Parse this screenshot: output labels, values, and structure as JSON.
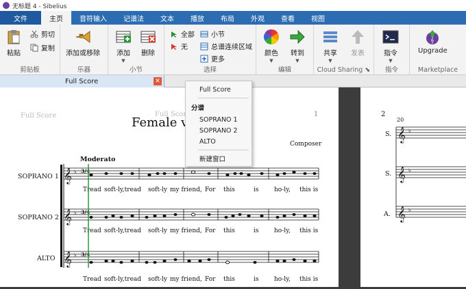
{
  "window": {
    "title": "无标题 4 - Sibelius"
  },
  "tabs": [
    {
      "label": "文件"
    },
    {
      "label": "主页"
    },
    {
      "label": "音符输入"
    },
    {
      "label": "记谱法"
    },
    {
      "label": "文本"
    },
    {
      "label": "播放"
    },
    {
      "label": "布局"
    },
    {
      "label": "外观"
    },
    {
      "label": "查看"
    },
    {
      "label": "视图"
    }
  ],
  "ribbon": {
    "clipboard": {
      "label": "剪贴板",
      "paste": "粘贴",
      "cut": "剪切",
      "copy": "复制"
    },
    "instruments": {
      "label": "乐器",
      "add_remove": "添加或移除"
    },
    "bars": {
      "label": "小节",
      "add": "添加",
      "delete": "删除"
    },
    "select": {
      "label": "选择",
      "all": "全部",
      "none": "无",
      "more": "更多",
      "bar": "小节",
      "system_passage": "总谱连续区域"
    },
    "edit": {
      "label": "编辑",
      "color": "颜色",
      "goto": "转到"
    },
    "cloud": {
      "label": "Cloud Sharing",
      "share": "共享",
      "publish": "发表"
    },
    "commands": {
      "label": "指令",
      "command": "指令"
    },
    "marketplace": {
      "label": "Marketplace",
      "upgrade": "Upgrade"
    }
  },
  "doc_tab": {
    "label": "Full Score",
    "close": "✕"
  },
  "menu": {
    "full_score": "Full Score",
    "parts_header": "分谱",
    "parts": [
      "SOPRANO 1",
      "SOPRANO 2",
      "ALTO"
    ],
    "new_window": "新建窗口"
  },
  "score": {
    "header_left": "Full Score",
    "header_center": "Full Score",
    "page_number": "1",
    "title": "Female vo",
    "composer": "Composer",
    "tempo": "Moderato",
    "staves": [
      "SOPRANO 1",
      "SOPRANO 2",
      "ALTO"
    ],
    "time_signature": "3/4",
    "lyrics": [
      "Tread",
      "soft-ly,tread",
      "soft-ly",
      "my friend,",
      "For",
      "this",
      "is",
      "ho-ly,",
      "this is"
    ],
    "page2_number": "2",
    "page2_bar_number": "20",
    "page2_staves": [
      "S.",
      "S.",
      "A."
    ]
  },
  "colors": {
    "accent": "#2b6cb3",
    "close": "#e05a3a",
    "playback_line": "#2a9a3a"
  }
}
